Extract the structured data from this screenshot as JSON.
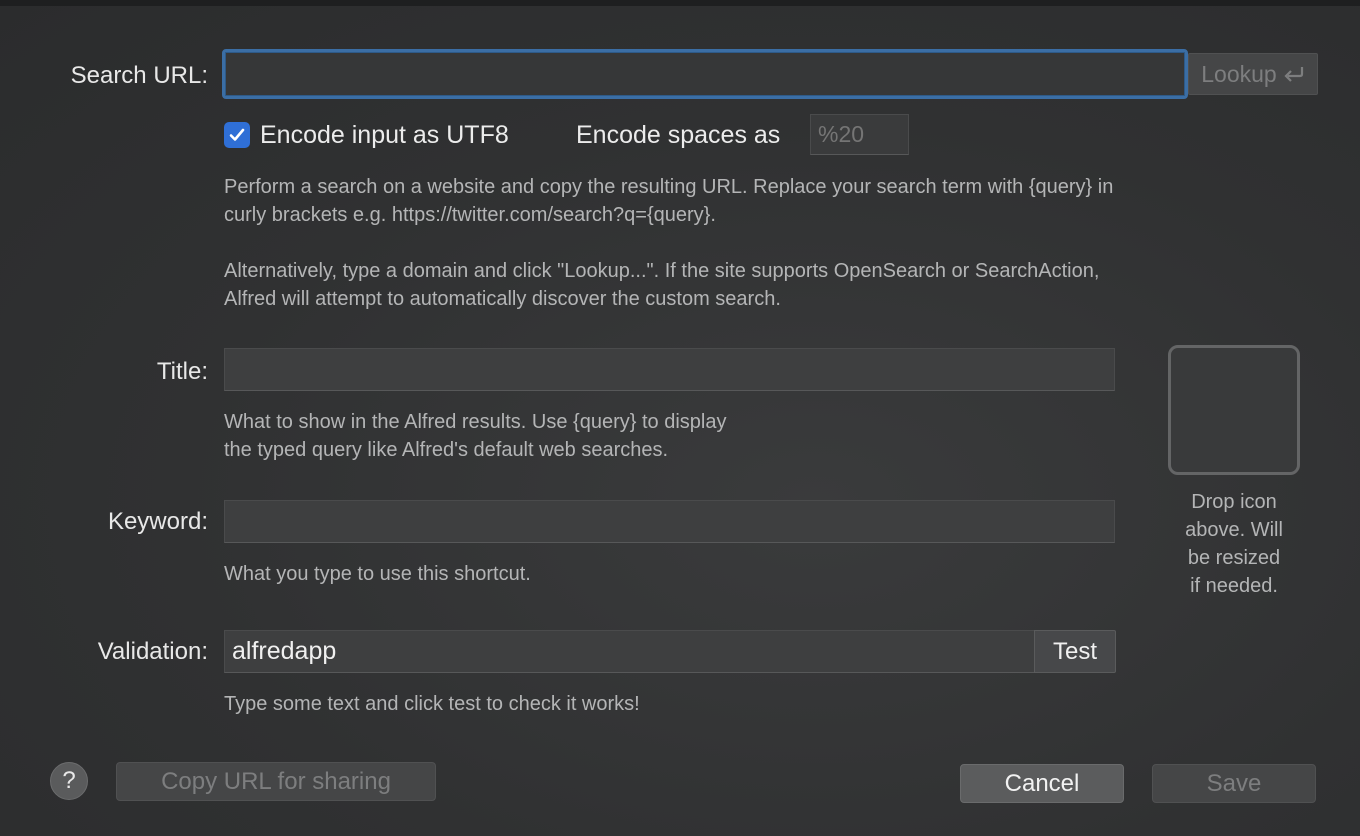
{
  "search_url": {
    "label": "Search URL:",
    "value": "",
    "lookup_label": "Lookup",
    "lookup_icon": "return-arrow-icon"
  },
  "encoding": {
    "utf8_label": "Encode input as UTF8",
    "utf8_checked": true,
    "spaces_label": "Encode spaces as",
    "spaces_placeholder": "%20"
  },
  "search_help": {
    "line1": "Perform a search on a website and copy the resulting URL. Replace your search term with {query} in",
    "line2": "curly brackets e.g. https://twitter.com/search?q={query}.",
    "line3": "Alternatively, type a domain and click \"Lookup...\". If the site supports OpenSearch or SearchAction,",
    "line4": "Alfred will attempt to automatically discover the custom search."
  },
  "title": {
    "label": "Title:",
    "value": "",
    "hint_line1": "What to show in the Alfred results. Use {query} to display",
    "hint_line2": "the typed query like Alfred's default web searches."
  },
  "keyword": {
    "label": "Keyword:",
    "value": "",
    "hint": "What you type to use this shortcut."
  },
  "validation": {
    "label": "Validation:",
    "value": "alfredapp",
    "test_label": "Test",
    "hint": "Type some text and click test to check it works!"
  },
  "icon_drop": {
    "line1": "Drop icon",
    "line2": "above. Will",
    "line3": "be resized",
    "line4": "if needed."
  },
  "footer": {
    "help_label": "?",
    "copy_url_label": "Copy URL for sharing",
    "cancel_label": "Cancel",
    "save_label": "Save"
  },
  "colors": {
    "accent": "#2f6fd6",
    "focus_ring": "#3b6ea5",
    "background": "#303132"
  }
}
